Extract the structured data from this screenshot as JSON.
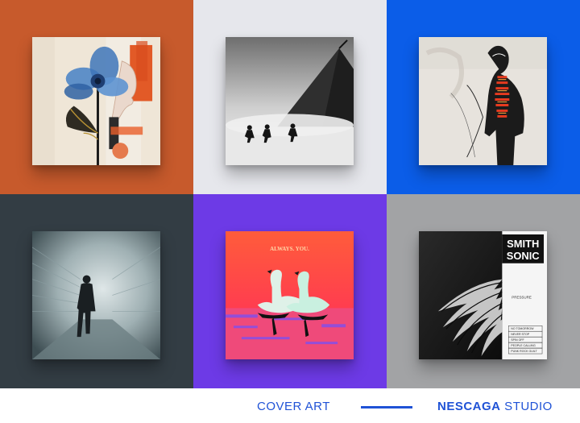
{
  "tiles": [
    {
      "id": "flower-portrait",
      "background": "#c75a2c"
    },
    {
      "id": "runners-in-storm",
      "background": "#e6e7ec"
    },
    {
      "id": "spine-figure",
      "background": "#0b5de8"
    },
    {
      "id": "figure-in-tunnel",
      "background": "#333d44"
    },
    {
      "id": "swans",
      "background": "#6d3ae6",
      "cover_text": "ALWAYS. YOU."
    },
    {
      "id": "smith-sonic",
      "background": "#a2a3a5",
      "cover_title_line1": "SMITH",
      "cover_title_line2": "SONIC",
      "album": "PRESSURE",
      "tracklist": [
        "NO TOMORROW",
        "NEVER STOP",
        "SPIN OFF",
        "PEOPLE CALLING",
        "PUNK ROCK GUILT"
      ]
    }
  ],
  "footer": {
    "label": "COVER ART",
    "brand_strong": "NESCAGA",
    "brand_light": " STUDIO",
    "accent": "#1f52d6"
  }
}
